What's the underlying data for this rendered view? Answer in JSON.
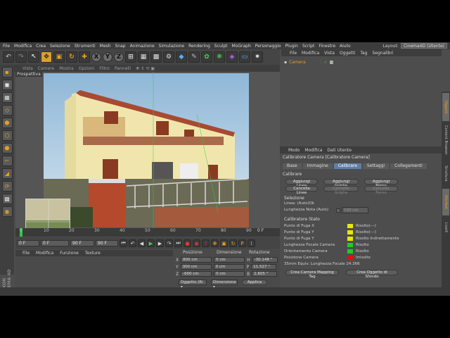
{
  "app": {
    "menu": [
      "File",
      "Modifica",
      "Crea",
      "Selezione",
      "Strumenti",
      "Mesh",
      "Snap",
      "Animazione",
      "Simulazione",
      "Rendering",
      "Sculpt",
      "MoGraph",
      "Personaggio",
      "Plugin",
      "Script",
      "Finestre",
      "Aiuto"
    ],
    "layout_label": "Layout:",
    "layout_value": "Cinema4D (Utente)",
    "brand": "MAXON CINEMA 4D"
  },
  "viewport": {
    "menu": [
      "Vista",
      "Camere",
      "Mostra",
      "Opzioni",
      "Filtro",
      "Pannelli"
    ],
    "label": "Prospettiva"
  },
  "timeline": {
    "ticks": [
      "0",
      "10",
      "20",
      "30",
      "40",
      "50",
      "60",
      "70",
      "80",
      "90"
    ],
    "end_marker": "0 F",
    "start_frame": "0 F",
    "current_frame": "0 F",
    "end_frame": "90 F",
    "end_frame2": "90 F"
  },
  "material": {
    "menu": [
      "File",
      "Modifica",
      "Funzione",
      "Texture"
    ]
  },
  "coords": {
    "headers": [
      "Posizione",
      "Dimensione",
      "Rotazione"
    ],
    "rows": [
      {
        "axis": "X",
        "pos": "800 cm",
        "dim": "0 cm",
        "rot_axis": "H",
        "rot": "-30.148 °"
      },
      {
        "axis": "Y",
        "pos": "300 cm",
        "dim": "0 cm",
        "rot_axis": "P",
        "rot": "11.527 °"
      },
      {
        "axis": "Z",
        "pos": "-600 cm",
        "dim": "0 cm",
        "rot_axis": "B",
        "rot": "1.605 °"
      }
    ],
    "mode1": "Oggetto (Ri ▾",
    "mode2": "Dimensione ▾",
    "apply": "Applica"
  },
  "object_manager": {
    "menu": [
      "File",
      "Modifica",
      "Vista",
      "Oggetti",
      "Tag",
      "Segnalibri"
    ],
    "object_name": "Camera"
  },
  "attributes": {
    "menu": [
      "Modo",
      "Modifica",
      "Dati Utente"
    ],
    "title": "Calibratore Camera [Calibratore Camera]",
    "tabs": [
      "Base",
      "Immagine",
      "Calibrare",
      "Settaggi",
      "Collegamenti"
    ],
    "active_tab": "Calibrare",
    "section_calibrare": "Calibrare",
    "buttons_row1": [
      "Aggiungi Linee",
      "Aggiungi Griglia",
      "Aggiungi Perno"
    ],
    "buttons_row2": [
      "Cancella Linee",
      "Cancella Griglia",
      "Cancella Perno"
    ],
    "selezione": "Selezione",
    "linea": "Linea: (Auto)Ok",
    "lunghezza_nota": "Lunghezza Nota (Auto)",
    "lunghezza_value": "100 cm",
    "stato_title": "Calibratore Stato",
    "status_rows": [
      {
        "label": "Punto di Fuga X",
        "color": "#e8e800",
        "value": "Risolto(---)"
      },
      {
        "label": "Punto di Fuga Y",
        "color": "#e8e800",
        "value": "Risolto(---)"
      },
      {
        "label": "Punto di Fuga Y",
        "color": "#e8e800",
        "value": "Risolto Indirettamente"
      },
      {
        "label": "Lunghezza Focale Camera",
        "color": "#22cc22",
        "value": "Risolto"
      },
      {
        "label": "Orientamento Camera",
        "color": "#22cc22",
        "value": "Risolto"
      },
      {
        "label": "Posizione Camera",
        "color": "#dd1111",
        "value": "Irrisolto"
      }
    ],
    "equiv": "35mm Equiv. Lunghezza Focale 24.366",
    "btn_create_tag": "Crea Camera Mapping Tag",
    "btn_create_bg": "Crea Oggetto di Sfondo"
  },
  "right_tabs": [
    "Oggetti",
    "Content Browser",
    "Struttura",
    "Attributi",
    "Livelli"
  ]
}
